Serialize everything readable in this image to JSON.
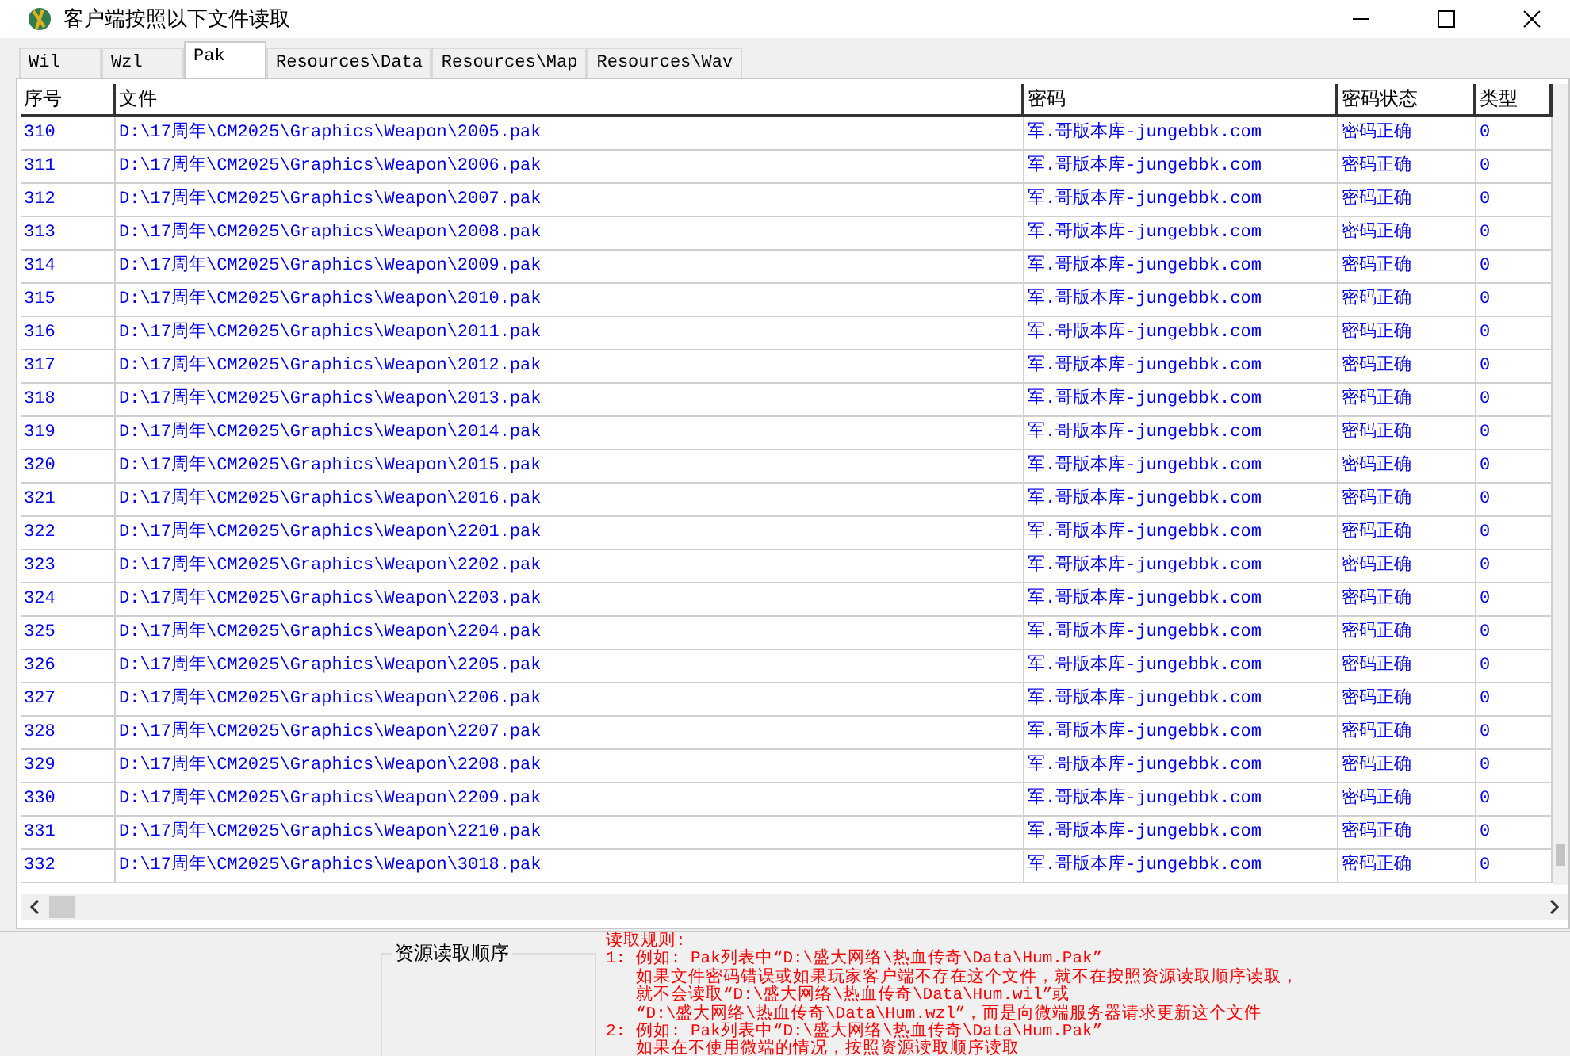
{
  "window": {
    "title": "客户端按照以下文件读取"
  },
  "tabs": [
    {
      "label": "Wil",
      "selected": false
    },
    {
      "label": "Wzl",
      "selected": false
    },
    {
      "label": "Pak",
      "selected": true
    },
    {
      "label": "Resources\\Data",
      "selected": false
    },
    {
      "label": "Resources\\Map",
      "selected": false
    },
    {
      "label": "Resources\\Wav",
      "selected": false
    }
  ],
  "table": {
    "columns": [
      "序号",
      "文件",
      "密码",
      "密码状态",
      "类型"
    ],
    "rows": [
      [
        "310",
        "D:\\17周年\\CM2025\\Graphics\\Weapon\\2005.pak",
        "军.哥版本库-jungebbk.com",
        "密码正确",
        "0"
      ],
      [
        "311",
        "D:\\17周年\\CM2025\\Graphics\\Weapon\\2006.pak",
        "军.哥版本库-jungebbk.com",
        "密码正确",
        "0"
      ],
      [
        "312",
        "D:\\17周年\\CM2025\\Graphics\\Weapon\\2007.pak",
        "军.哥版本库-jungebbk.com",
        "密码正确",
        "0"
      ],
      [
        "313",
        "D:\\17周年\\CM2025\\Graphics\\Weapon\\2008.pak",
        "军.哥版本库-jungebbk.com",
        "密码正确",
        "0"
      ],
      [
        "314",
        "D:\\17周年\\CM2025\\Graphics\\Weapon\\2009.pak",
        "军.哥版本库-jungebbk.com",
        "密码正确",
        "0"
      ],
      [
        "315",
        "D:\\17周年\\CM2025\\Graphics\\Weapon\\2010.pak",
        "军.哥版本库-jungebbk.com",
        "密码正确",
        "0"
      ],
      [
        "316",
        "D:\\17周年\\CM2025\\Graphics\\Weapon\\2011.pak",
        "军.哥版本库-jungebbk.com",
        "密码正确",
        "0"
      ],
      [
        "317",
        "D:\\17周年\\CM2025\\Graphics\\Weapon\\2012.pak",
        "军.哥版本库-jungebbk.com",
        "密码正确",
        "0"
      ],
      [
        "318",
        "D:\\17周年\\CM2025\\Graphics\\Weapon\\2013.pak",
        "军.哥版本库-jungebbk.com",
        "密码正确",
        "0"
      ],
      [
        "319",
        "D:\\17周年\\CM2025\\Graphics\\Weapon\\2014.pak",
        "军.哥版本库-jungebbk.com",
        "密码正确",
        "0"
      ],
      [
        "320",
        "D:\\17周年\\CM2025\\Graphics\\Weapon\\2015.pak",
        "军.哥版本库-jungebbk.com",
        "密码正确",
        "0"
      ],
      [
        "321",
        "D:\\17周年\\CM2025\\Graphics\\Weapon\\2016.pak",
        "军.哥版本库-jungebbk.com",
        "密码正确",
        "0"
      ],
      [
        "322",
        "D:\\17周年\\CM2025\\Graphics\\Weapon\\2201.pak",
        "军.哥版本库-jungebbk.com",
        "密码正确",
        "0"
      ],
      [
        "323",
        "D:\\17周年\\CM2025\\Graphics\\Weapon\\2202.pak",
        "军.哥版本库-jungebbk.com",
        "密码正确",
        "0"
      ],
      [
        "324",
        "D:\\17周年\\CM2025\\Graphics\\Weapon\\2203.pak",
        "军.哥版本库-jungebbk.com",
        "密码正确",
        "0"
      ],
      [
        "325",
        "D:\\17周年\\CM2025\\Graphics\\Weapon\\2204.pak",
        "军.哥版本库-jungebbk.com",
        "密码正确",
        "0"
      ],
      [
        "326",
        "D:\\17周年\\CM2025\\Graphics\\Weapon\\2205.pak",
        "军.哥版本库-jungebbk.com",
        "密码正确",
        "0"
      ],
      [
        "327",
        "D:\\17周年\\CM2025\\Graphics\\Weapon\\2206.pak",
        "军.哥版本库-jungebbk.com",
        "密码正确",
        "0"
      ],
      [
        "328",
        "D:\\17周年\\CM2025\\Graphics\\Weapon\\2207.pak",
        "军.哥版本库-jungebbk.com",
        "密码正确",
        "0"
      ],
      [
        "329",
        "D:\\17周年\\CM2025\\Graphics\\Weapon\\2208.pak",
        "军.哥版本库-jungebbk.com",
        "密码正确",
        "0"
      ],
      [
        "330",
        "D:\\17周年\\CM2025\\Graphics\\Weapon\\2209.pak",
        "军.哥版本库-jungebbk.com",
        "密码正确",
        "0"
      ],
      [
        "331",
        "D:\\17周年\\CM2025\\Graphics\\Weapon\\2210.pak",
        "军.哥版本库-jungebbk.com",
        "密码正确",
        "0"
      ],
      [
        "332",
        "D:\\17周年\\CM2025\\Graphics\\Weapon\\3018.pak",
        "军.哥版本库-jungebbk.com",
        "密码正确",
        "0"
      ]
    ]
  },
  "order_group": {
    "title": "资源读取顺序"
  },
  "rules": [
    "读取规则:",
    "1: 例如: Pak列表中“D:\\盛大网络\\热血传奇\\Data\\Hum.Pak”",
    "如果文件密码错误或如果玩家客户端不存在这个文件，就不在按照资源读取顺序读取，",
    "就不会读取“D:\\盛大网络\\热血传奇\\Data\\Hum.wil”或",
    "“D:\\盛大网络\\热血传奇\\Data\\Hum.wzl”，而是向微端服务器请求更新这个文件",
    "2: 例如: Pak列表中“D:\\盛大网络\\热血传奇\\Data\\Hum.Pak”",
    "如果在不使用微端的情况，按照资源读取顺序读取"
  ]
}
